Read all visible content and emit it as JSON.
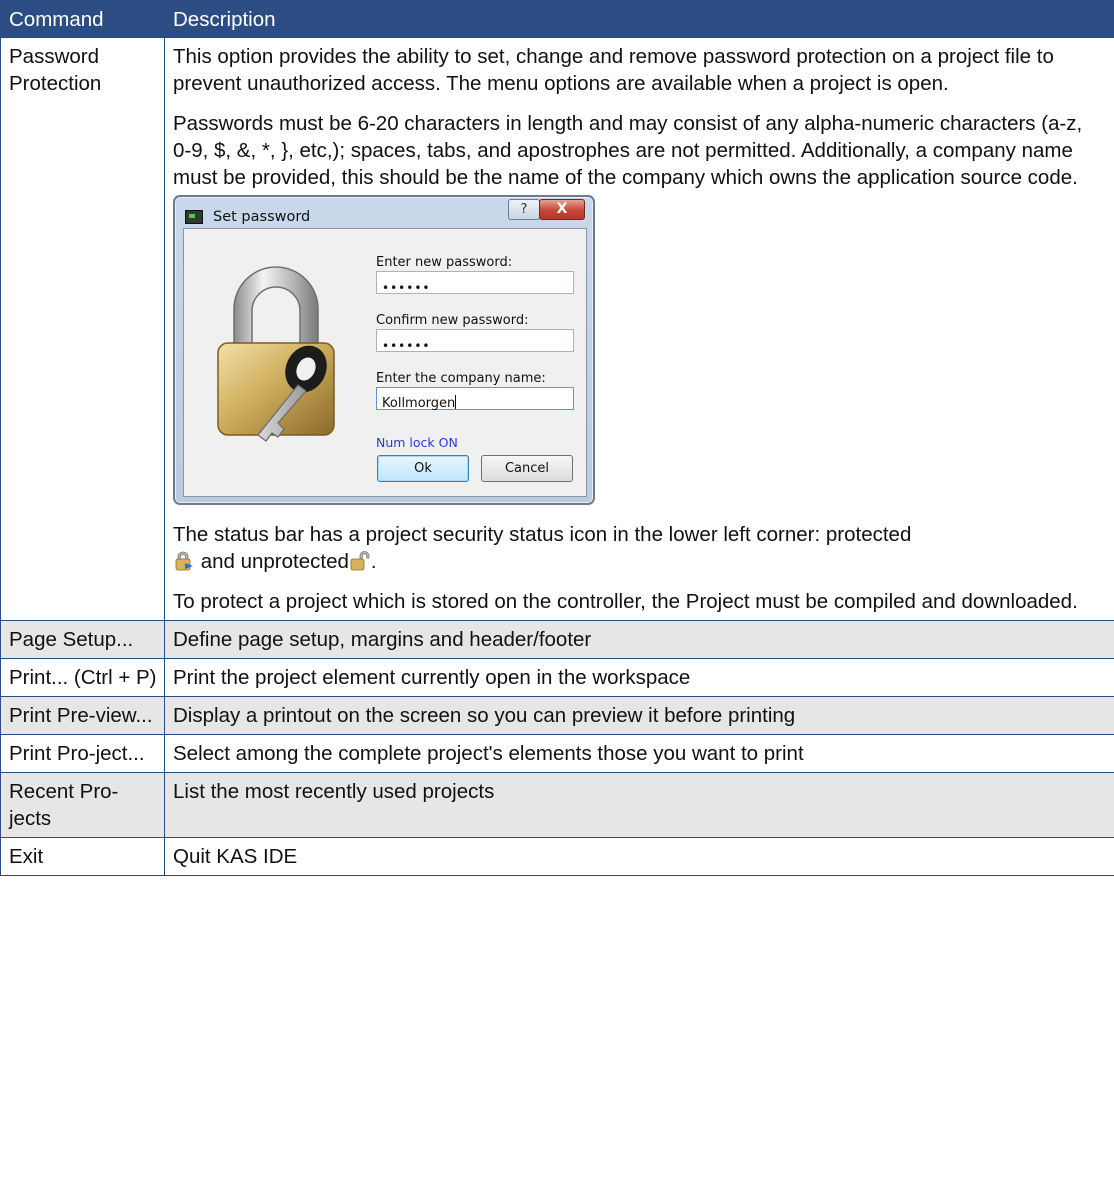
{
  "header": {
    "col1": "Command",
    "col2": "Description"
  },
  "password_row": {
    "command": "Password Protection",
    "para1": "This option provides the ability to set, change and remove password protection on a project file to prevent unauthorized access. The menu options are available when a project is open.",
    "para2": "Passwords must be 6-20 characters in length and may consist of any alpha-numeric characters (a-z, 0-9, $, &, *, }, etc,); spaces, tabs, and apostrophes are not permitted. Additionally, a company name must be provided, this should be the name of the company which owns the application source code.",
    "status_prefix": "The status bar has a project security status icon in the lower left corner: protected",
    "status_mid": "and unprotected",
    "status_end": ".",
    "para4": "To protect a project which is stored on the controller, the Project must be compiled and downloaded.",
    "icons": {
      "protected": "lock-closed-icon",
      "unprotected": "lock-open-icon"
    }
  },
  "dialog": {
    "title": "Set password",
    "help_label": "?",
    "close_label": "X",
    "new_password_label": "Enter new password:",
    "new_password_value": "••••••",
    "confirm_label": "Confirm new password:",
    "confirm_value": "••••••",
    "company_label": "Enter the company name:",
    "company_value": "Kollmorgen",
    "numlock_text": "Num lock ON",
    "ok_label": "Ok",
    "cancel_label": "Cancel",
    "colors": {
      "numlock": "#2a38d8",
      "close": "#c4473a"
    }
  },
  "rows": [
    {
      "command": "Page Setup...",
      "description": "Define page setup, margins and header/footer"
    },
    {
      "command": "Print... (Ctrl + P)",
      "description": "Print the project element currently open in the workspace"
    },
    {
      "command": "Print Pre-view...",
      "description": "Display a printout on the screen so you can preview it before printing"
    },
    {
      "command": "Print Pro-ject...",
      "description": "Select among the complete project's elements those you want to print"
    },
    {
      "command": "Recent Pro-jects",
      "description": "List the most recently used projects"
    },
    {
      "command": "Exit",
      "description": "Quit KAS IDE"
    }
  ],
  "colors": {
    "header_bg": "#2c4d84",
    "row_shade": "#e6e6e6"
  }
}
